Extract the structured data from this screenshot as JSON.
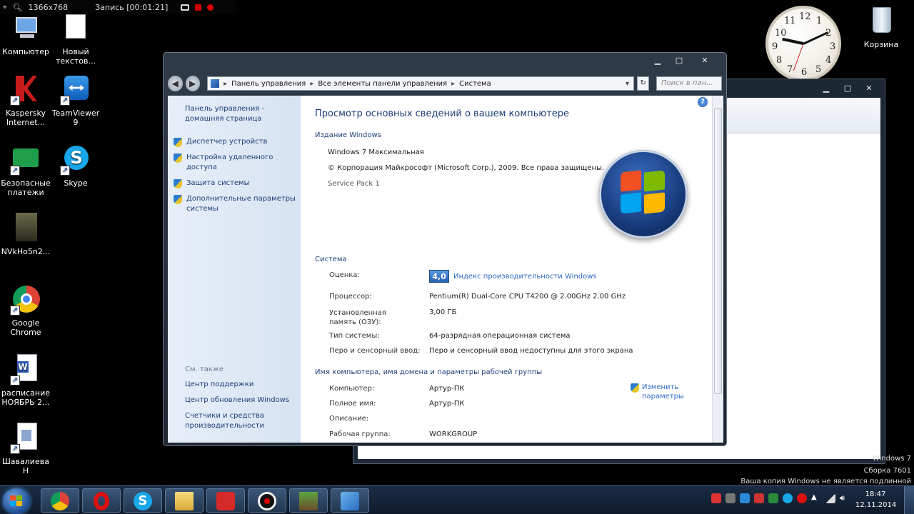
{
  "recorder": {
    "resolution": "1366x768",
    "status": "Запись [00:01:21]"
  },
  "desktop_icons": [
    {
      "label": "Компьютер"
    },
    {
      "label": "Новый текстов..."
    },
    {
      "label": "Kaspersky Internet..."
    },
    {
      "label": "TeamViewer 9"
    },
    {
      "label": "Безопасные платежи"
    },
    {
      "label": "Skype"
    },
    {
      "label": "NVkHo5n2..."
    },
    {
      "label": "Google Chrome"
    },
    {
      "label": "расписание НОЯБРЬ 2..."
    },
    {
      "label": "Шавалиева Н"
    },
    {
      "label": "Корзина"
    }
  ],
  "clock_gadget": {
    "numerals": [
      "12",
      "1",
      "2",
      "3",
      "4",
      "5",
      "6",
      "7",
      "8",
      "9",
      "10",
      "11"
    ],
    "time": "18:47"
  },
  "window": {
    "title_buttons": {
      "minimize": "▁",
      "maximize": "□",
      "close": "✕"
    },
    "breadcrumb": [
      "Панель управления",
      "Все элементы панели управления",
      "Система"
    ],
    "search_placeholder": "Поиск в пан...",
    "left": {
      "home_link": "Панель управления - домашняя страница",
      "tasks": [
        "Диспетчер устройств",
        "Настройка удаленного доступа",
        "Защита системы",
        "Дополнительные параметры системы"
      ],
      "see_also_title": "См. также",
      "see_also": [
        "Центр поддержки",
        "Центр обновления Windows",
        "Счетчики и средства производительности"
      ]
    },
    "content": {
      "heading": "Просмотр основных сведений о вашем компьютере",
      "edition_title": "Издание Windows",
      "edition": "Windows 7 Максимальная",
      "copyright": "© Корпорация Майкрософт (Microsoft Corp.), 2009. Все права защищены.",
      "service_pack": "Service Pack 1",
      "system_title": "Система",
      "rating_label": "Оценка:",
      "rating_value": "4,0",
      "rating_link": "Индекс производительности Windows",
      "rows": [
        {
          "label": "Процессор:",
          "value": "Pentium(R) Dual-Core CPU      T4200  @ 2.00GHz   2.00 GHz"
        },
        {
          "label": "Установленная память (ОЗУ):",
          "value": "3,00 ГБ"
        },
        {
          "label": "Тип системы:",
          "value": "64-разрядная операционная система"
        },
        {
          "label": "Перо и сенсорный ввод:",
          "value": "Перо и сенсорный ввод недоступны для этого экрана"
        }
      ],
      "name_title": "Имя компьютера, имя домена и параметры рабочей группы",
      "name_rows": [
        {
          "label": "Компьютер:",
          "value": "Артур-ПК"
        },
        {
          "label": "Полное имя:",
          "value": "Артур-ПК"
        },
        {
          "label": "Описание:",
          "value": ""
        },
        {
          "label": "Рабочая группа:",
          "value": "WORKGROUP"
        }
      ],
      "change_link": "Изменить параметры"
    }
  },
  "watermark": {
    "line1": "Windows 7",
    "line2": "Сборка 7601",
    "line3": "Ваша копия Windows не является подлинной"
  },
  "taskbar": {
    "time": "18:47",
    "date": "12.11.2014"
  },
  "colors": {
    "link": "#1e3e78",
    "accent": "#2c67c6",
    "taskbar": "#1a2c44"
  }
}
